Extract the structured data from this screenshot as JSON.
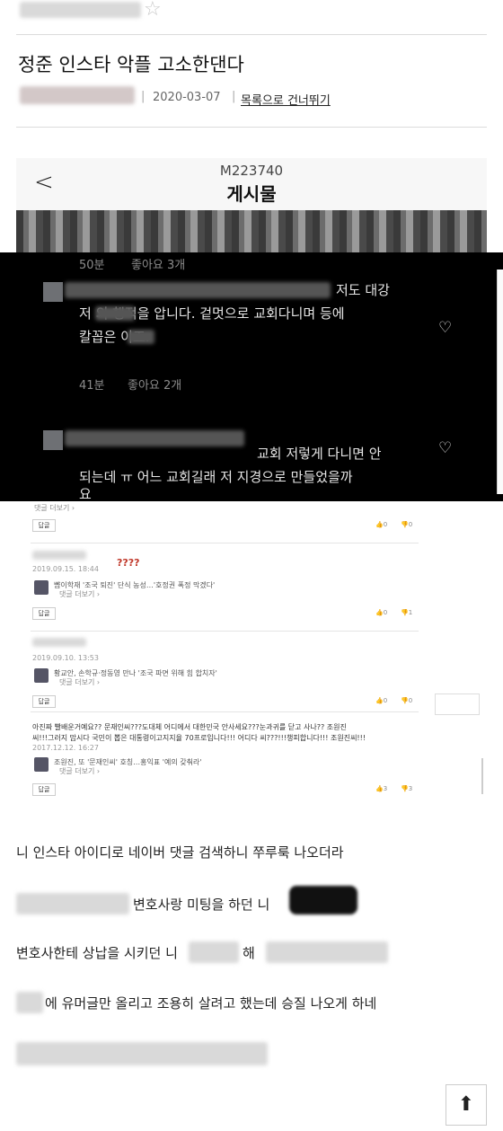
{
  "header": {
    "star_icon": "star-outline-icon",
    "title": "정준 인스타 악플 고소한댄다",
    "date": "2020-03-07",
    "separator": "|",
    "list_link": "목록으로 건너뛰기"
  },
  "app_screenshot": {
    "back_icon": "chevron-left-icon",
    "back_glyph": "<",
    "post_id": "M223740",
    "heading": "게시물"
  },
  "dark_comments": {
    "top_meta": {
      "time": "50분",
      "likes": "좋아요 3개"
    },
    "comments": [
      {
        "line1_tail": "저도 대강",
        "line2": "저      의 행적을 압니다. 겉멋으로 교회다니며 등에",
        "line3": "칼꼽은       이죠.",
        "time": "41분",
        "likes": "좋아요 2개"
      },
      {
        "line1_tail": "교회 저렇게 다니면 안",
        "line2": "되는데 ㅠ 어느 교회길래 저 지경으로 만들었을까",
        "line3": "요"
      }
    ],
    "heart_glyph": "♡"
  },
  "news_comments": {
    "more_replies": "댓글 더보기 ›",
    "reply_label": "답글",
    "entries": [
      {
        "votes_up": "0",
        "votes_down": "0"
      },
      {
        "annotation": "????",
        "date": "2019.09.15. 18:44",
        "headline": "뺨이학재 '조국 퇴진' 단식 농성…'호정권 폭정 막겠다'",
        "votes_up": "0",
        "votes_down": "1"
      },
      {
        "date": "2019.09.10. 13:53",
        "headline": "황교안, 손학규·정동영 만나 '조국 파면 위해 힘 합치자'",
        "votes_up": "0",
        "votes_down": "0"
      },
      {
        "body1": "아진짜 빨배운거예요?? 문재인씨???도대체 어디에서 대한민국 안사세요???눈과귀를 닫고 사나?? 조원진",
        "body2": "씨!!!그러지 맙시다 국민이 뽑은 대통령이고지지율 70프로입니다!!! 어디다 씨???!!!챙피합니다!!! 조원진씨!!!",
        "date": "2017.12.12. 16:27",
        "headline": "조원진, 또 '문재인씨' 호칭…홍익표 '예의 갖춰라'",
        "votes_up": "3",
        "votes_down": "3"
      }
    ]
  },
  "body_text": {
    "p1": "니 인스타 아이디로 네이버 댓글 검색하니 쭈루룩 나오더라",
    "p2": "변호사랑 미팅을 하던 니",
    "p3a": "변호사한테 상납을 시키던 니",
    "p3b": "해",
    "p4": "에 유머글만 올리고 조용히 살려고 했는데 승질 나오게 하네"
  },
  "top_button": {
    "icon": "arrow-up-icon",
    "glyph": "⬆"
  }
}
